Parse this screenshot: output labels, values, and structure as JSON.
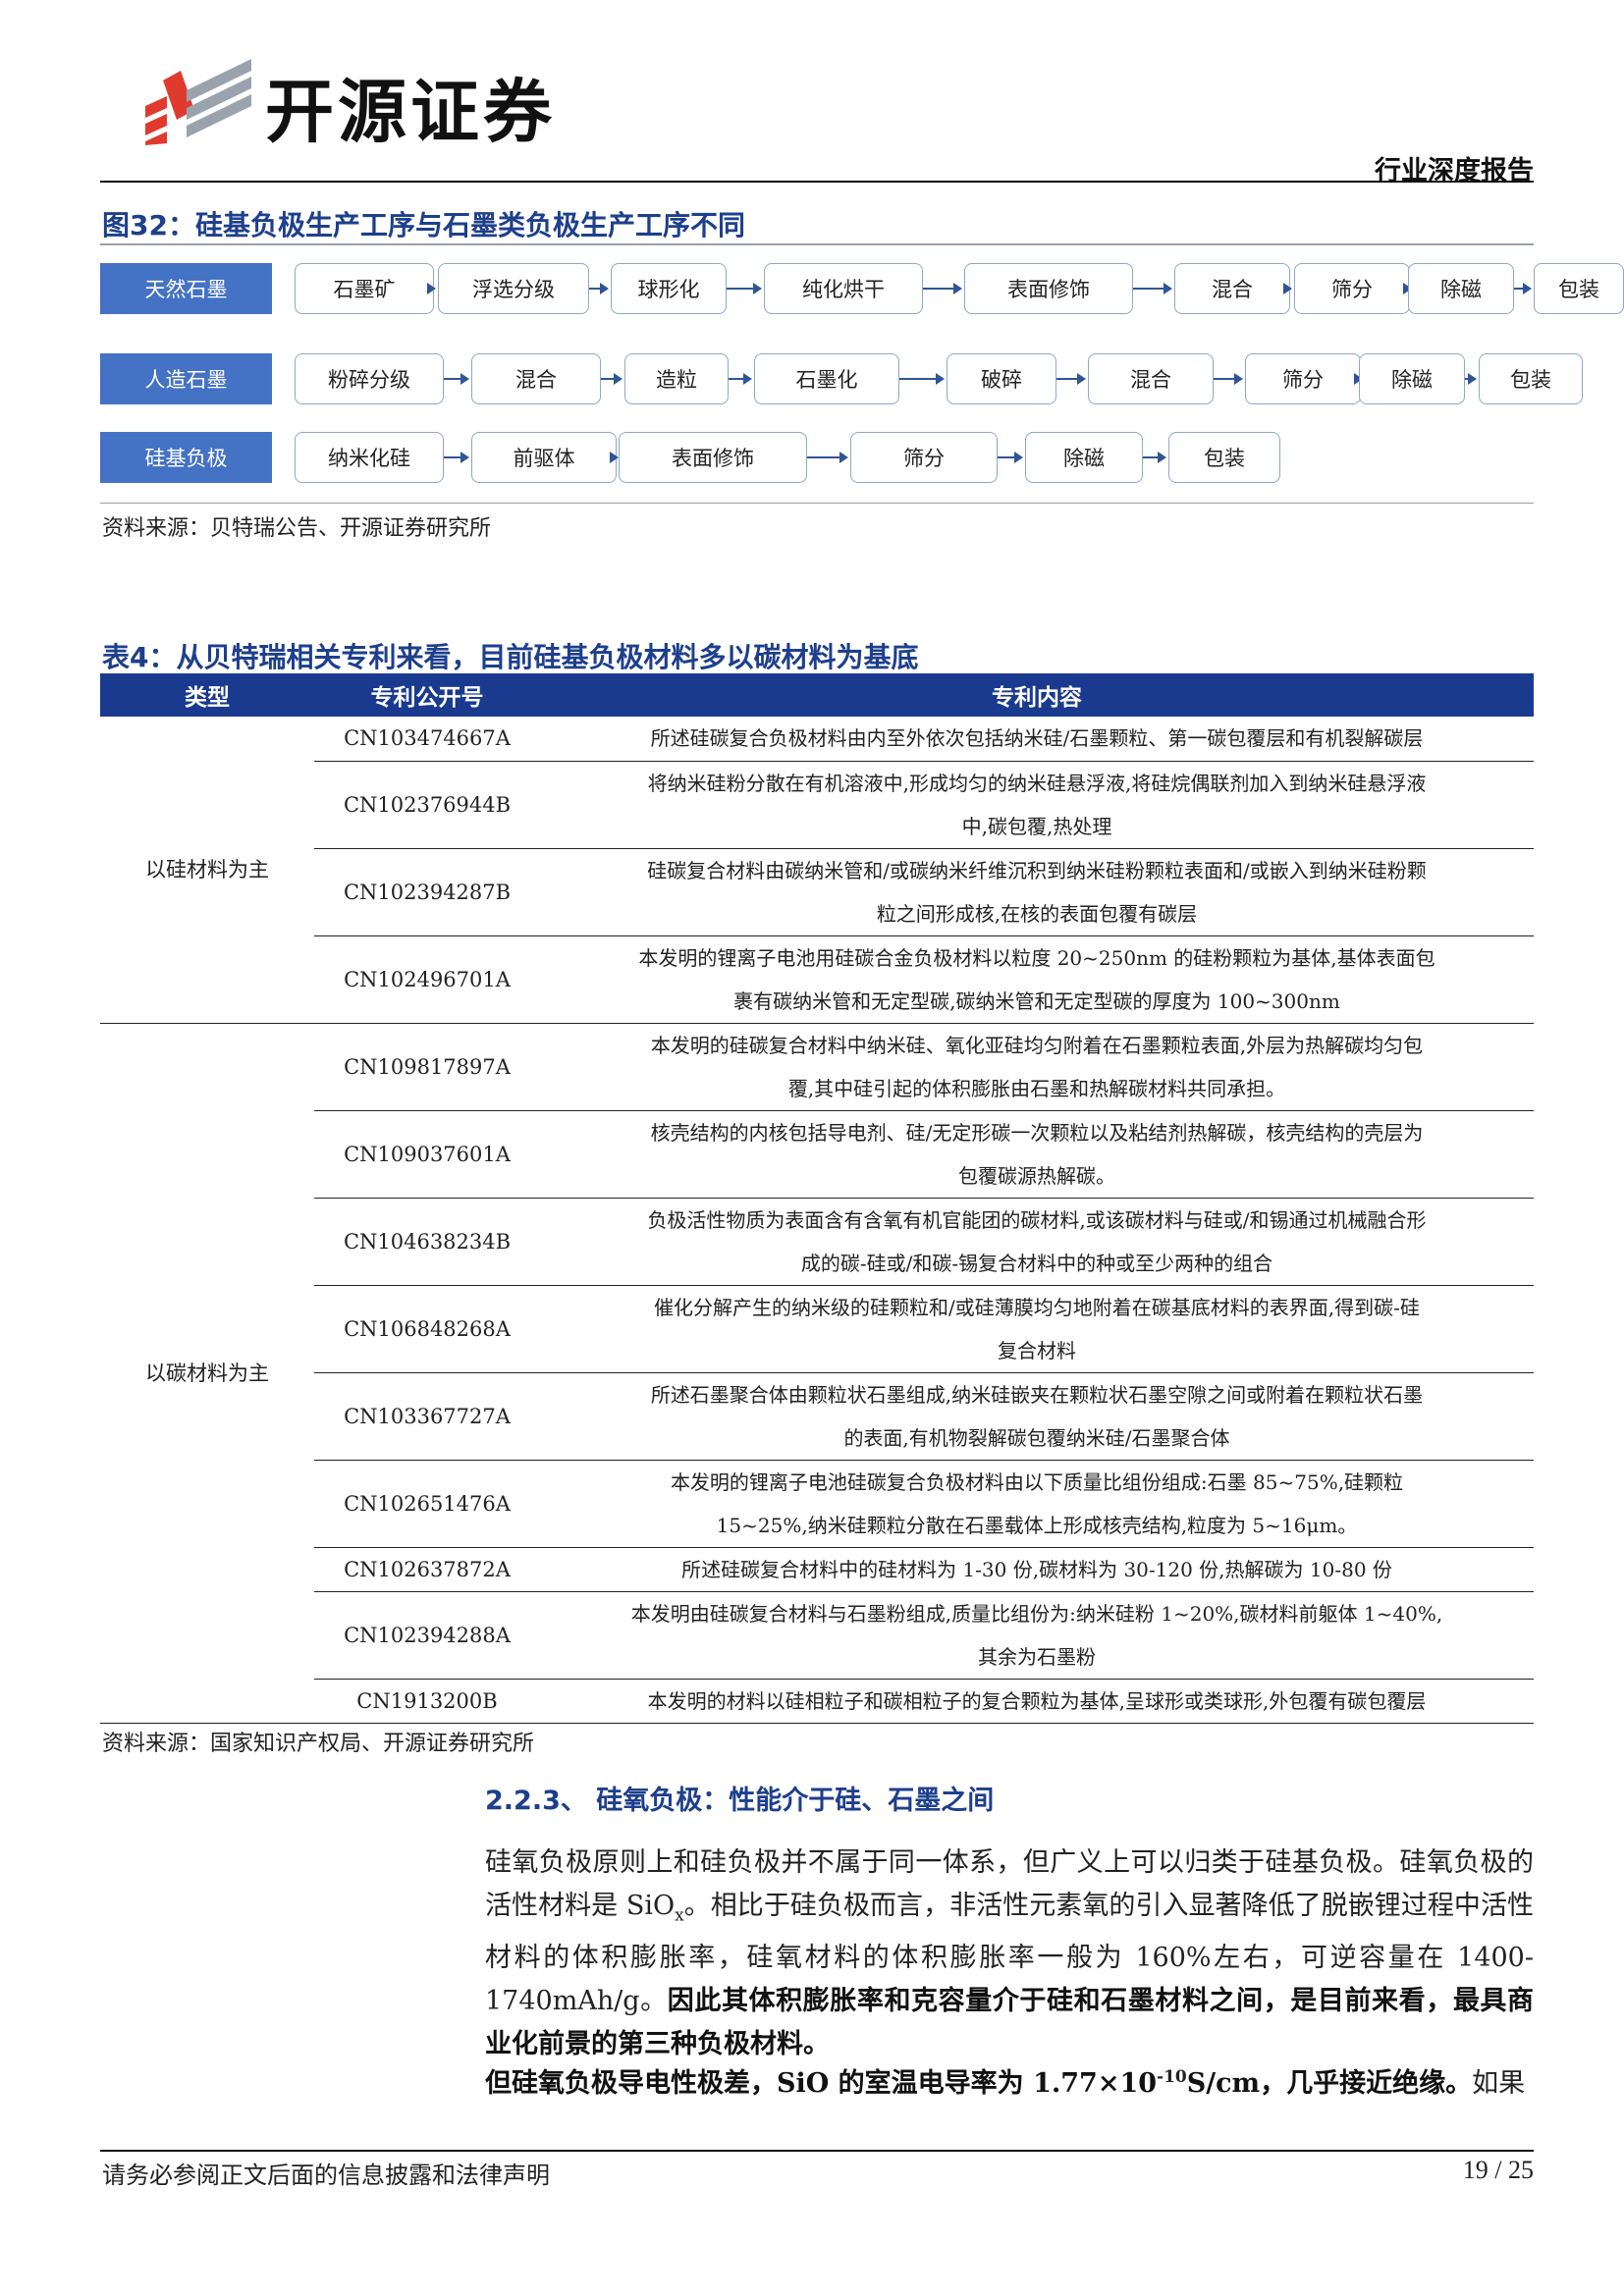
{
  "header": {
    "logo_text": "开源证券",
    "report_type": "行业深度报告"
  },
  "figure": {
    "caption": "图32：硅基负极生产工序与石墨类负极生产工序不同",
    "rows": [
      {
        "label": "天然石墨",
        "steps": [
          "石墨矿",
          "浮选分级",
          "球形化",
          "纯化烘干",
          "表面修饰",
          "混合",
          "筛分",
          "除磁",
          "包装"
        ]
      },
      {
        "label": "人造石墨",
        "steps": [
          "粉碎分级",
          "混合",
          "造粒",
          "石墨化",
          "破碎",
          "混合",
          "筛分",
          "除磁",
          "包装"
        ]
      },
      {
        "label": "硅基负极",
        "steps": [
          "纳米化硅",
          "前驱体",
          "表面修饰",
          "筛分",
          "除磁",
          "包装"
        ]
      }
    ],
    "source": "资料来源：贝特瑞公告、开源证券研究所"
  },
  "table": {
    "caption": "表4：从贝特瑞相关专利来看，目前硅基负极材料多以碳材料为基底",
    "headers": [
      "类型",
      "专利公开号",
      "专利内容"
    ],
    "groups": [
      {
        "type": "以硅材料为主",
        "rows": [
          {
            "no": "CN103474667A",
            "lines": [
              "所述硅碳复合负极材料由内至外依次包括纳米硅/石墨颗粒、第一碳包覆层和有机裂解碳层"
            ]
          },
          {
            "no": "CN102376944B",
            "lines": [
              "将纳米硅粉分散在有机溶液中,形成均匀的纳米硅悬浮液,将硅烷偶联剂加入到纳米硅悬浮液",
              "中,碳包覆,热处理"
            ]
          },
          {
            "no": "CN102394287B",
            "lines": [
              "硅碳复合材料由碳纳米管和/或碳纳米纤维沉积到纳米硅粉颗粒表面和/或嵌入到纳米硅粉颗",
              "粒之间形成核,在核的表面包覆有碳层"
            ]
          },
          {
            "no": "CN102496701A",
            "lines": [
              "本发明的锂离子电池用硅碳合金负极材料以粒度 20~250nm 的硅粉颗粒为基体,基体表面包",
              "裹有碳纳米管和无定型碳,碳纳米管和无定型碳的厚度为 100~300nm"
            ]
          }
        ]
      },
      {
        "type": "以碳材料为主",
        "rows": [
          {
            "no": "CN109817897A",
            "lines": [
              "本发明的硅碳复合材料中纳米硅、氧化亚硅均匀附着在石墨颗粒表面,外层为热解碳均匀包",
              "覆,其中硅引起的体积膨胀由石墨和热解碳材料共同承担。"
            ]
          },
          {
            "no": "CN109037601A",
            "lines": [
              "核壳结构的内核包括导电剂、硅/无定形碳一次颗粒以及粘结剂热解碳，核壳结构的壳层为",
              "包覆碳源热解碳。"
            ]
          },
          {
            "no": "CN104638234B",
            "lines": [
              "负极活性物质为表面含有含氧有机官能团的碳材料,或该碳材料与硅或/和锡通过机械融合形",
              "成的碳-硅或/和碳-锡复合材料中的种或至少两种的组合"
            ]
          },
          {
            "no": "CN106848268A",
            "lines": [
              "催化分解产生的纳米级的硅颗粒和/或硅薄膜均匀地附着在碳基底材料的表界面,得到碳-硅",
              "复合材料"
            ]
          },
          {
            "no": "CN103367727A",
            "lines": [
              "所述石墨聚合体由颗粒状石墨组成,纳米硅嵌夹在颗粒状石墨空隙之间或附着在颗粒状石墨",
              "的表面,有机物裂解碳包覆纳米硅/石墨聚合体"
            ]
          },
          {
            "no": "CN102651476A",
            "lines": [
              "本发明的锂离子电池硅碳复合负极材料由以下质量比组份组成:石墨 85~75%,硅颗粒",
              "15~25%,纳米硅颗粒分散在石墨载体上形成核壳结构,粒度为 5~16μm。"
            ]
          },
          {
            "no": "CN102637872A",
            "lines": [
              "所述硅碳复合材料中的硅材料为 1-30 份,碳材料为 30-120 份,热解碳为 10-80 份"
            ]
          },
          {
            "no": "CN102394288A",
            "lines": [
              "本发明由硅碳复合材料与石墨粉组成,质量比组份为:纳米硅粉 1~20%,碳材料前躯体 1~40%,",
              "其余为石墨粉"
            ]
          },
          {
            "no": "CN1913200B",
            "lines": [
              "本发明的材料以硅相粒子和碳相粒子的复合颗粒为基体,呈球形或类球形,外包覆有碳包覆层"
            ]
          }
        ]
      }
    ],
    "source": "资料来源：国家知识产权局、开源证券研究所"
  },
  "section": {
    "heading": "2.2.3、 硅氧负极：性能介于硅、石墨之间",
    "p1_a": "硅氧负极原则上和硅负极并不属于同一体系，但广义上可以归类于硅基负极。硅氧负极的活性材料是 SiO",
    "p1_sub": "x",
    "p1_b": "。相比于硅负极而言，非活性元素氧的引入显著降低了脱嵌锂过程中活性材料的体积膨胀率，硅氧材料的体积膨胀率一般为 160%左右，可逆容量在 1400-1740mAh/g。",
    "p1_bold": "因此其体积膨胀率和克容量介于硅和石墨材料之间，是目前来看，最具商业化前景的第三种负极材料。",
    "p2_bold_a": "但硅氧负极导电性极差，SiO 的室温电导率为 1.77×10",
    "p2_sup": "-10",
    "p2_bold_b": "S/cm，几乎接近绝缘。",
    "p2_tail": "如果"
  },
  "footer": {
    "disclaimer": "请务必参阅正文后面的信息披露和法律声明",
    "page": "19 / 25"
  },
  "colors": {
    "brand_red": "#e03a2f",
    "brand_gray": "#9aa3ad",
    "caption_blue": "#1e3f8c",
    "label_blue": "#4472c4",
    "table_header": "#1a3a8f"
  }
}
